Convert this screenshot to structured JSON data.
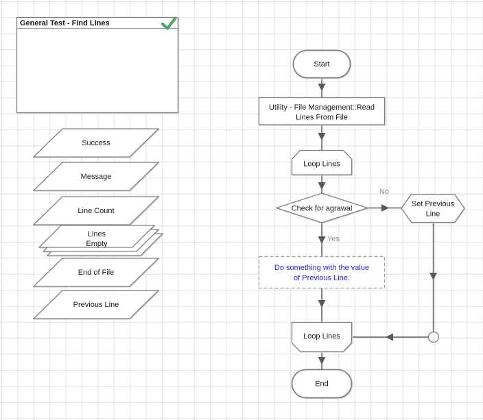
{
  "process_box": {
    "title": "General Test - Find Lines",
    "status_icon": "check-icon"
  },
  "data_items": [
    {
      "label": "Success"
    },
    {
      "label": "Message"
    },
    {
      "label": "Line Count"
    },
    {
      "label": "Lines",
      "status": "Empty",
      "collection": true
    },
    {
      "label": "End of File"
    },
    {
      "label": "Previous Line"
    }
  ],
  "flow": {
    "start_label": "Start",
    "action_label_line1": "Utility - File Management::Read",
    "action_label_line2": "Lines From File",
    "loop_start_label": "Loop Lines",
    "decision_label": "Check for agrawal",
    "no_label": "No",
    "yes_label": "Yes",
    "calc_label_line1": "Set Previous",
    "calc_label_line2": "Line",
    "note_line1": "Do something with the value",
    "note_line2": "of Previous Line.",
    "loop_end_label": "Loop Lines",
    "end_label": "End"
  },
  "colors": {
    "note_text": "#2323e8",
    "status_check": "#4ba56f",
    "link": "#595959",
    "branch_label": "#8f8f8f",
    "shape_border": "#7f7f7f",
    "grid_line": "#e1e1e5"
  }
}
